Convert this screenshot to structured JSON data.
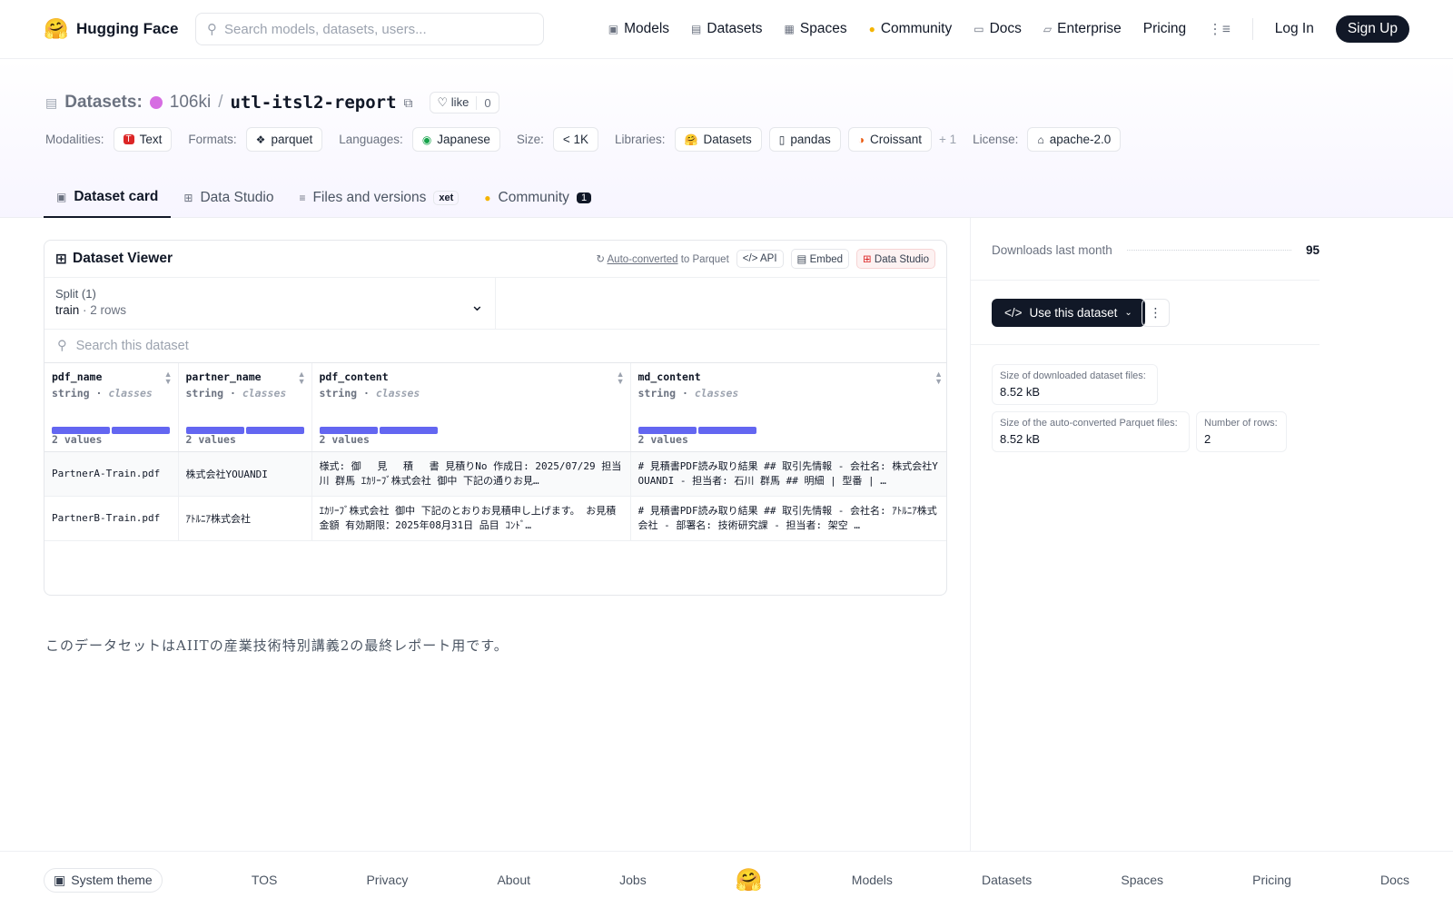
{
  "header": {
    "brand": "Hugging Face",
    "search_placeholder": "Search models, datasets, users...",
    "nav": [
      {
        "label": "Models",
        "icon": "cube-icon"
      },
      {
        "label": "Datasets",
        "icon": "database-icon"
      },
      {
        "label": "Spaces",
        "icon": "grid-icon"
      },
      {
        "label": "Community",
        "icon": "community-icon"
      },
      {
        "label": "Docs",
        "icon": "book-icon"
      },
      {
        "label": "Enterprise",
        "icon": "enterprise-icon"
      },
      {
        "label": "Pricing"
      }
    ],
    "login": "Log In",
    "signup": "Sign Up"
  },
  "repo": {
    "type_label": "Datasets:",
    "owner": "106ki",
    "separator": "/",
    "name": "utl-itsl2-report",
    "like_label": "like",
    "like_count": "0",
    "meta": {
      "modalities_label": "Modalities:",
      "modalities": [
        "Text"
      ],
      "formats_label": "Formats:",
      "formats": [
        "parquet"
      ],
      "languages_label": "Languages:",
      "languages": [
        "Japanese"
      ],
      "size_label": "Size:",
      "size": "< 1K",
      "libraries_label": "Libraries:",
      "libraries": [
        "Datasets",
        "pandas",
        "Croissant"
      ],
      "libraries_more": "+ 1",
      "license_label": "License:",
      "license": "apache-2.0"
    },
    "tabs": [
      {
        "label": "Dataset card",
        "active": true
      },
      {
        "label": "Data Studio"
      },
      {
        "label": "Files and versions",
        "badge": "xet"
      },
      {
        "label": "Community",
        "count": "1"
      }
    ]
  },
  "viewer": {
    "title": "Dataset Viewer",
    "auto_converted": "Auto-converted",
    "to_parquet": " to Parquet",
    "api": "API",
    "embed": "Embed",
    "data_studio": "Data Studio",
    "split_label": "Split (1)",
    "split_value": "train",
    "split_dot": "·",
    "split_rows": "2 rows",
    "search_placeholder": "Search this dataset",
    "columns": [
      {
        "name": "pdf_name",
        "type": "string",
        "kind": "classes",
        "values": "2 values"
      },
      {
        "name": "partner_name",
        "type": "string",
        "kind": "classes",
        "values": "2 values"
      },
      {
        "name": "pdf_content",
        "type": "string",
        "kind": "classes",
        "values": "2 values"
      },
      {
        "name": "md_content",
        "type": "string",
        "kind": "classes",
        "values": "2 values"
      }
    ],
    "rows": [
      [
        "PartnerA-Train.pdf",
        "株式会社YOUANDI",
        "様式: 御 　見 　積 　書 見積りNo 作成日: 2025/07/29 担当 川 群馬 ｴｶﾘｰﾌﾞ株式会社 御中 下記の通りお見…",
        "# 見積書PDF読み取り結果 ## 取引先情報 - 会社名: 株式会社YOUANDI - 担当者: 石川 群馬 ## 明細 | 型番 | …"
      ],
      [
        "PartnerB-Train.pdf",
        "ｱﾄﾙﾆｱ株式会社",
        "ｴｶﾘｰﾌﾞ株式会社 御中 下記のとおりお見積申し上げます。 お見積金額 有効期限：2025年08月31日 品目 ｺﾝﾄﾞ…",
        "# 見積書PDF読み取り結果 ## 取引先情報 - 会社名: ｱﾄﾙﾆｱ株式会社 - 部署名: 技術研究課 - 担当者: 架空 …"
      ]
    ]
  },
  "description": "このデータセットはAIITの産業技術特別講義2の最終レポート用です。",
  "sidebar": {
    "downloads_label": "Downloads last month",
    "downloads": "95",
    "use_button": "Use this dataset",
    "size_downloaded_label": "Size of downloaded dataset files:",
    "size_downloaded": "8.52 kB",
    "size_parquet_label": "Size of the auto-converted Parquet files:",
    "size_parquet": "8.52 kB",
    "num_rows_label": "Number of rows:",
    "num_rows": "2"
  },
  "footer": {
    "theme": "System theme",
    "links": [
      "TOS",
      "Privacy",
      "About",
      "Jobs",
      "Models",
      "Datasets",
      "Spaces",
      "Pricing",
      "Docs"
    ]
  }
}
